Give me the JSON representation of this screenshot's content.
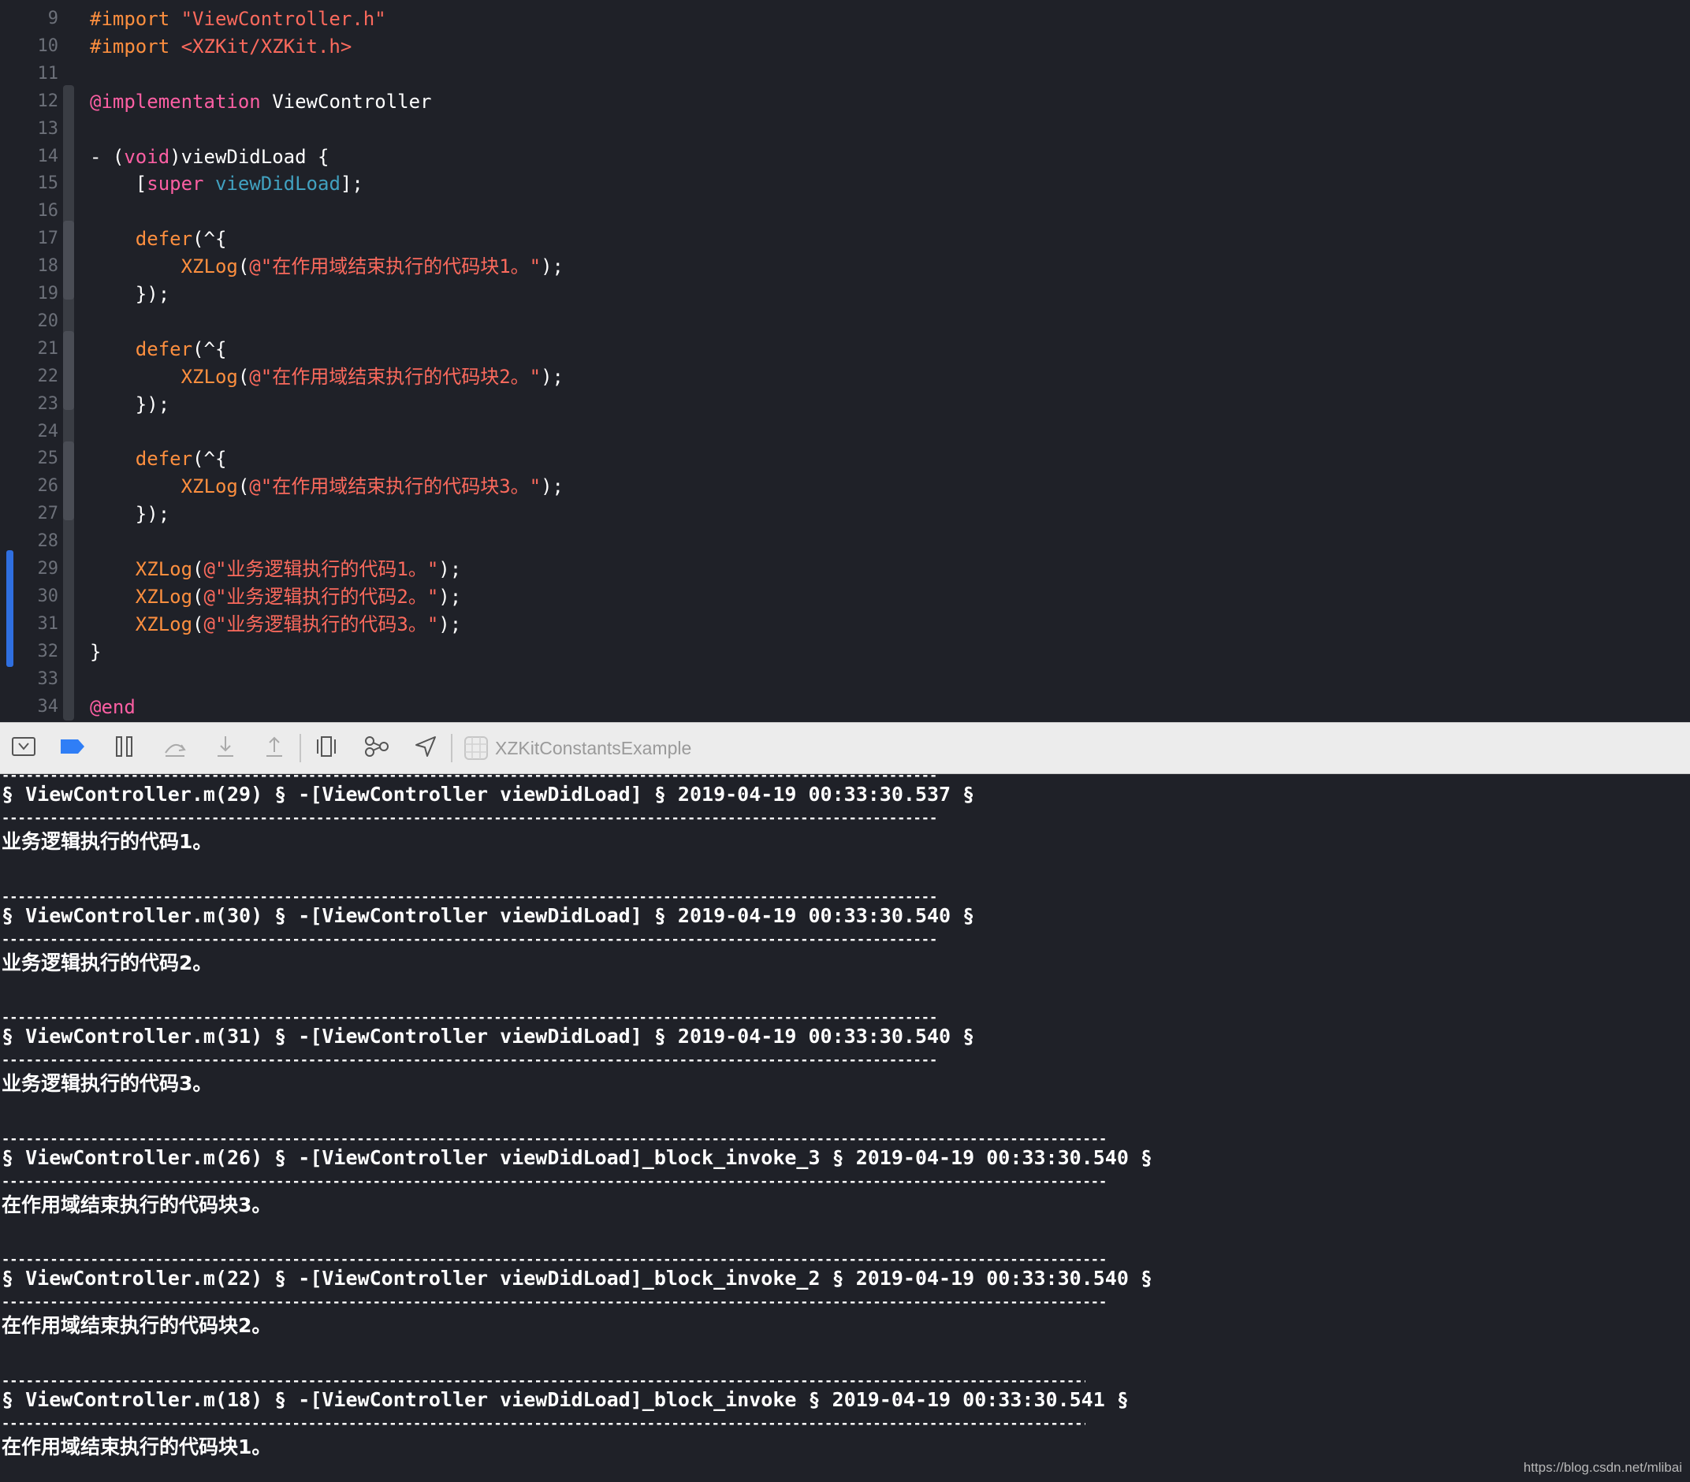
{
  "editor": {
    "lines": [
      {
        "num": "9",
        "tokens": [
          {
            "t": "#import ",
            "c": "t-preproc"
          },
          {
            "t": "\"ViewController.h\"",
            "c": "t-string"
          }
        ]
      },
      {
        "num": "10",
        "tokens": [
          {
            "t": "#import ",
            "c": "t-preproc"
          },
          {
            "t": "<XZKit/XZKit.h>",
            "c": "t-string"
          }
        ]
      },
      {
        "num": "11",
        "tokens": []
      },
      {
        "num": "12",
        "tokens": [
          {
            "t": "@implementation",
            "c": "t-keyword"
          },
          {
            "t": " ViewController",
            "c": "t-normal"
          }
        ]
      },
      {
        "num": "13",
        "tokens": []
      },
      {
        "num": "14",
        "tokens": [
          {
            "t": "- (",
            "c": "t-normal"
          },
          {
            "t": "void",
            "c": "t-keyword"
          },
          {
            "t": ")viewDidLoad {",
            "c": "t-normal"
          }
        ]
      },
      {
        "num": "15",
        "tokens": [
          {
            "t": "    [",
            "c": "t-normal"
          },
          {
            "t": "super",
            "c": "t-keyword"
          },
          {
            "t": " ",
            "c": "t-normal"
          },
          {
            "t": "viewDidLoad",
            "c": "t-method"
          },
          {
            "t": "];",
            "c": "t-normal"
          }
        ]
      },
      {
        "num": "16",
        "tokens": []
      },
      {
        "num": "17",
        "tokens": [
          {
            "t": "    ",
            "c": "t-normal"
          },
          {
            "t": "defer",
            "c": "t-macro"
          },
          {
            "t": "(^{",
            "c": "t-normal"
          }
        ]
      },
      {
        "num": "18",
        "tokens": [
          {
            "t": "        ",
            "c": "t-normal"
          },
          {
            "t": "XZLog",
            "c": "t-macro"
          },
          {
            "t": "(",
            "c": "t-normal"
          },
          {
            "t": "@\"在作用域结束执行的代码块1。\"",
            "c": "t-string"
          },
          {
            "t": ");",
            "c": "t-normal"
          }
        ]
      },
      {
        "num": "19",
        "tokens": [
          {
            "t": "    });",
            "c": "t-normal"
          }
        ]
      },
      {
        "num": "20",
        "tokens": []
      },
      {
        "num": "21",
        "tokens": [
          {
            "t": "    ",
            "c": "t-normal"
          },
          {
            "t": "defer",
            "c": "t-macro"
          },
          {
            "t": "(^{",
            "c": "t-normal"
          }
        ]
      },
      {
        "num": "22",
        "tokens": [
          {
            "t": "        ",
            "c": "t-normal"
          },
          {
            "t": "XZLog",
            "c": "t-macro"
          },
          {
            "t": "(",
            "c": "t-normal"
          },
          {
            "t": "@\"在作用域结束执行的代码块2。\"",
            "c": "t-string"
          },
          {
            "t": ");",
            "c": "t-normal"
          }
        ]
      },
      {
        "num": "23",
        "tokens": [
          {
            "t": "    });",
            "c": "t-normal"
          }
        ]
      },
      {
        "num": "24",
        "tokens": []
      },
      {
        "num": "25",
        "tokens": [
          {
            "t": "    ",
            "c": "t-normal"
          },
          {
            "t": "defer",
            "c": "t-macro"
          },
          {
            "t": "(^{",
            "c": "t-normal"
          }
        ]
      },
      {
        "num": "26",
        "tokens": [
          {
            "t": "        ",
            "c": "t-normal"
          },
          {
            "t": "XZLog",
            "c": "t-macro"
          },
          {
            "t": "(",
            "c": "t-normal"
          },
          {
            "t": "@\"在作用域结束执行的代码块3。\"",
            "c": "t-string"
          },
          {
            "t": ");",
            "c": "t-normal"
          }
        ]
      },
      {
        "num": "27",
        "tokens": [
          {
            "t": "    });",
            "c": "t-normal"
          }
        ]
      },
      {
        "num": "28",
        "tokens": []
      },
      {
        "num": "29",
        "tokens": [
          {
            "t": "    ",
            "c": "t-normal"
          },
          {
            "t": "XZLog",
            "c": "t-macro"
          },
          {
            "t": "(",
            "c": "t-normal"
          },
          {
            "t": "@\"业务逻辑执行的代码1。\"",
            "c": "t-string"
          },
          {
            "t": ");",
            "c": "t-normal"
          }
        ]
      },
      {
        "num": "30",
        "tokens": [
          {
            "t": "    ",
            "c": "t-normal"
          },
          {
            "t": "XZLog",
            "c": "t-macro"
          },
          {
            "t": "(",
            "c": "t-normal"
          },
          {
            "t": "@\"业务逻辑执行的代码2。\"",
            "c": "t-string"
          },
          {
            "t": ");",
            "c": "t-normal"
          }
        ]
      },
      {
        "num": "31",
        "tokens": [
          {
            "t": "    ",
            "c": "t-normal"
          },
          {
            "t": "XZLog",
            "c": "t-macro"
          },
          {
            "t": "(",
            "c": "t-normal"
          },
          {
            "t": "@\"业务逻辑执行的代码3。\"",
            "c": "t-string"
          },
          {
            "t": ");",
            "c": "t-normal"
          }
        ]
      },
      {
        "num": "32",
        "tokens": [
          {
            "t": "}",
            "c": "t-normal"
          }
        ]
      },
      {
        "num": "33",
        "tokens": []
      },
      {
        "num": "34",
        "tokens": [
          {
            "t": "@end",
            "c": "t-keyword"
          }
        ]
      }
    ]
  },
  "debug_bar": {
    "buttons": [
      {
        "name": "hide-debug-area-button",
        "icon": "hide-debug-area-icon"
      },
      {
        "name": "breakpoints-toggle-button",
        "icon": "breakpoint-icon"
      },
      {
        "name": "pause-button",
        "icon": "pause-icon"
      },
      {
        "name": "step-over-button",
        "icon": "step-over-icon"
      },
      {
        "name": "step-into-button",
        "icon": "step-into-icon"
      },
      {
        "name": "step-out-button",
        "icon": "step-out-icon"
      },
      {
        "name": "debug-view-hierarchy-button",
        "icon": "view-hierarchy-icon"
      },
      {
        "name": "debug-memory-graph-button",
        "icon": "memory-graph-icon"
      },
      {
        "name": "simulate-location-button",
        "icon": "location-arrow-icon"
      }
    ],
    "target": "XZKitConstantsExample"
  },
  "console": {
    "entries": [
      {
        "header": "§ ViewController.m(29) § -[ViewController viewDidLoad] § 2019-04-19 00:33:30.537 §",
        "message": "业务逻辑执行的代码1。"
      },
      {
        "header": "§ ViewController.m(30) § -[ViewController viewDidLoad] § 2019-04-19 00:33:30.540 §",
        "message": "业务逻辑执行的代码2。"
      },
      {
        "header": "§ ViewController.m(31) § -[ViewController viewDidLoad] § 2019-04-19 00:33:30.540 §",
        "message": "业务逻辑执行的代码3。"
      },
      {
        "header": "§ ViewController.m(26) § -[ViewController viewDidLoad]_block_invoke_3 § 2019-04-19 00:33:30.540 §",
        "message": "在作用域结束执行的代码块3。"
      },
      {
        "header": "§ ViewController.m(22) § -[ViewController viewDidLoad]_block_invoke_2 § 2019-04-19 00:33:30.540 §",
        "message": "在作用域结束执行的代码块2。"
      },
      {
        "header": "§ ViewController.m(18) § -[ViewController viewDidLoad]_block_invoke § 2019-04-19 00:33:30.541 §",
        "message": "在作用域结束执行的代码块1。"
      }
    ]
  },
  "watermark": "https://blog.csdn.net/mlibai",
  "colors": {
    "background": "#1f2128",
    "preprocessor": "#fd8f3f",
    "string": "#fc6a5d",
    "keyword": "#fc5fa3",
    "method": "#41a1c0",
    "change_bar": "#2f6fe0",
    "toolbar": "#ececec"
  }
}
